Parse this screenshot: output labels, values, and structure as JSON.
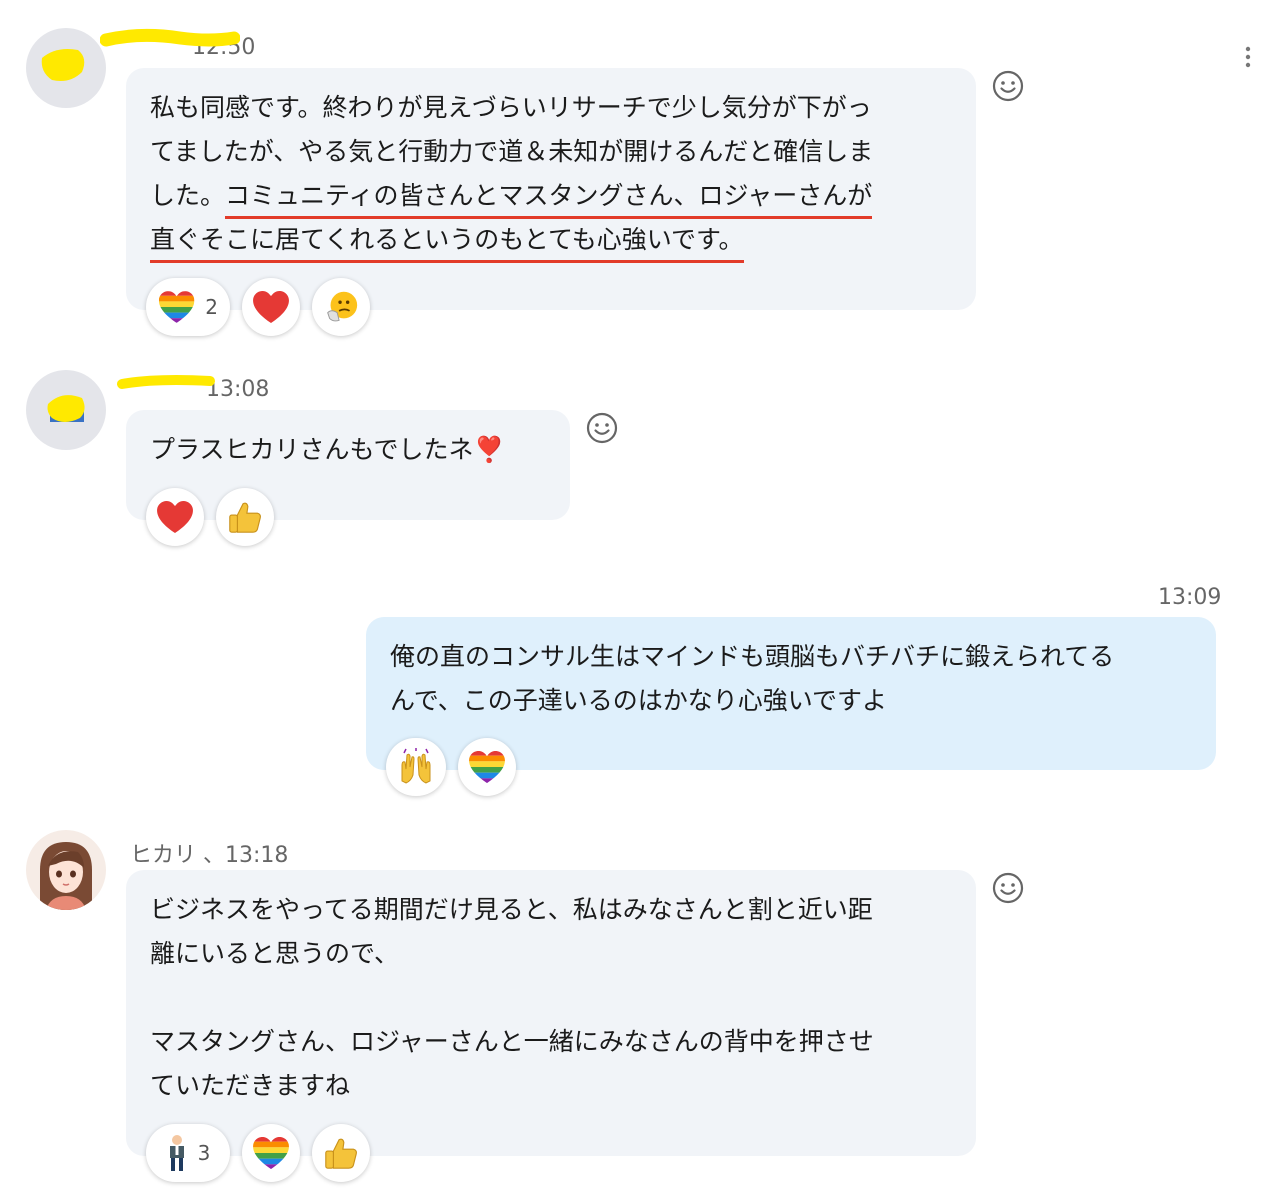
{
  "messages": [
    {
      "id": "m1",
      "time": "12:50",
      "name": "",
      "lines": [
        "私も同感です。終わりが見えづらいリサーチで少し気分が下がっ",
        "てましたが、やる気と行動力で道＆未知が開けるんだと確信しま"
      ],
      "line3_plain": "した。",
      "line3_underlined": "コミュニティの皆さんとマスタングさん、ロジャーさんが",
      "line4_underlined": "直ぐそこに居てくれるというのもとても心強いです。",
      "reactions": [
        {
          "icon": "rainbow-heart-icon",
          "count": "2"
        },
        {
          "icon": "red-heart-icon",
          "count": ""
        },
        {
          "icon": "thinking-face-icon",
          "count": ""
        }
      ]
    },
    {
      "id": "m2",
      "time": "13:08",
      "name": "",
      "lines": [
        "プラスヒカリさんもでしたネ❣️"
      ],
      "reactions": [
        {
          "icon": "red-heart-icon",
          "count": ""
        },
        {
          "icon": "thumbs-up-icon",
          "count": ""
        }
      ]
    },
    {
      "id": "m3",
      "time": "13:09",
      "lines": [
        "俺の直のコンサル生はマインドも頭脳もバチバチに鍛えられてる",
        "んで、この子達いるのはかなり心強いですよ"
      ],
      "reactions": [
        {
          "icon": "raising-hands-icon",
          "count": ""
        },
        {
          "icon": "rainbow-heart-icon",
          "count": ""
        }
      ]
    },
    {
      "id": "m4",
      "header": "ヒカリ 、13:18",
      "lines": [
        "ビジネスをやってる期間だけ見ると、私はみなさんと割と近い距",
        "離にいると思うので、",
        "",
        "マスタングさん、ロジャーさんと一緒にみなさんの背中を押させ",
        "ていただきますね"
      ],
      "reactions": [
        {
          "icon": "man-standing-icon",
          "count": "3"
        },
        {
          "icon": "rainbow-heart-icon",
          "count": ""
        },
        {
          "icon": "thumbs-up-icon",
          "count": ""
        }
      ]
    }
  ],
  "colors": {
    "bubble_other": "#f1f4f8",
    "bubble_self": "#dff0fc",
    "underline": "#e23b2a",
    "highlight": "#ffee00"
  }
}
